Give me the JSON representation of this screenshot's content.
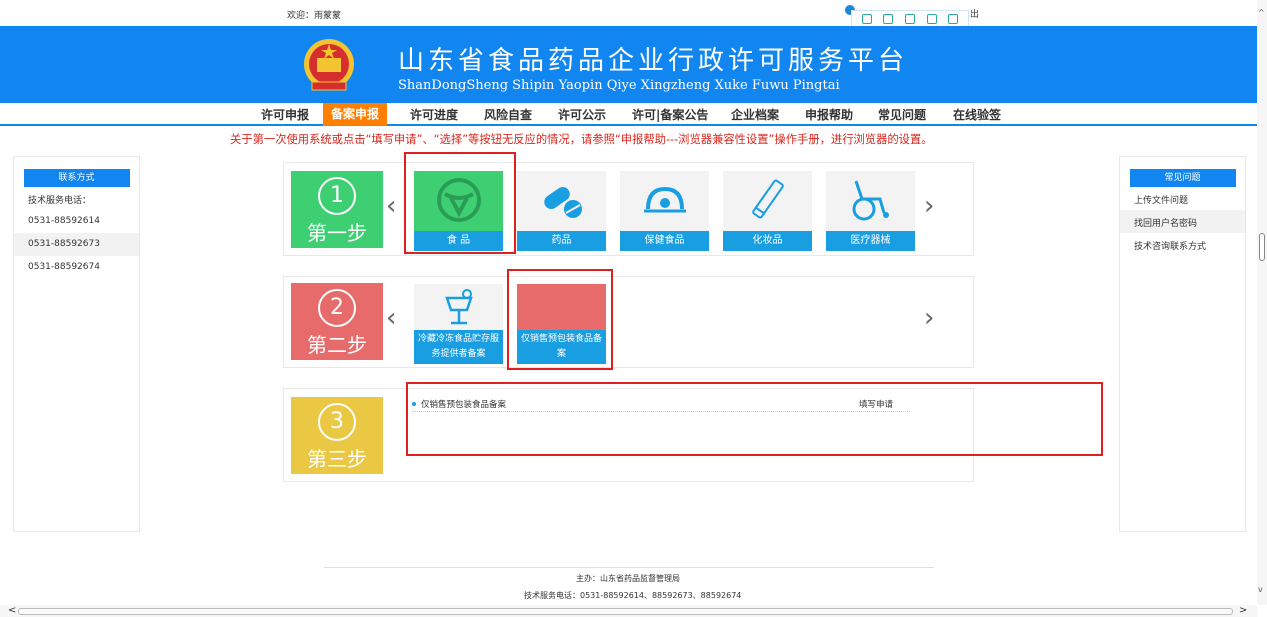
{
  "top": {
    "welcome": "欢迎：雨蒙蒙",
    "logout": "出"
  },
  "banner": {
    "title": "山东省食品药品企业行政许可服务平台",
    "subtitle": "ShanDongSheng Shipin Yaopin Qiye Xingzheng Xuke Fuwu Pingtai"
  },
  "nav": {
    "items": [
      "许可申报",
      "备案申报",
      "许可进度",
      "风险自查",
      "许可公示",
      "许可|备案公告",
      "企业档案",
      "申报帮助",
      "常见问题",
      "在线验签"
    ],
    "active_index": 1
  },
  "notice": "关于第一次使用系统或点击“填写申请”、“选择”等按钮无反应的情况，请参照“申报帮助---浏览器兼容性设置”操作手册，进行浏览器的设置。",
  "left_panel": {
    "header": "联系方式",
    "lines": [
      "技术服务电话：",
      "0531-88592614",
      "0531-88592673",
      "0531-88592674"
    ]
  },
  "right_panel": {
    "header": "常见问题",
    "lines": [
      "上传文件问题",
      "找回用户名密码",
      "技术咨询联系方式"
    ]
  },
  "steps": [
    {
      "num": "1",
      "label": "第一步",
      "color": "#3ecf73"
    },
    {
      "num": "2",
      "label": "第二步",
      "color": "#e86b6b"
    },
    {
      "num": "3",
      "label": "第三步",
      "color": "#eac843"
    }
  ],
  "step1_cards": [
    "食 品",
    "药品",
    "保健食品",
    "化妆品",
    "医疗器械"
  ],
  "step2_cards": [
    "冷藏冷冻食品贮存服务提供者备案",
    "仅销售预包装食品备案"
  ],
  "step3": {
    "item": "仅销售预包装食品备案",
    "action": "填写申请"
  },
  "footer": {
    "sponsor": "主办：山东省药品监督管理局",
    "phone": "技术服务电话：0531-88592614、88592673、88592674"
  },
  "colors": {
    "brand_blue": "#1186f0",
    "nav_active": "#ff8000",
    "highlight": "#e02020",
    "card_blue": "#1a9ee2"
  }
}
